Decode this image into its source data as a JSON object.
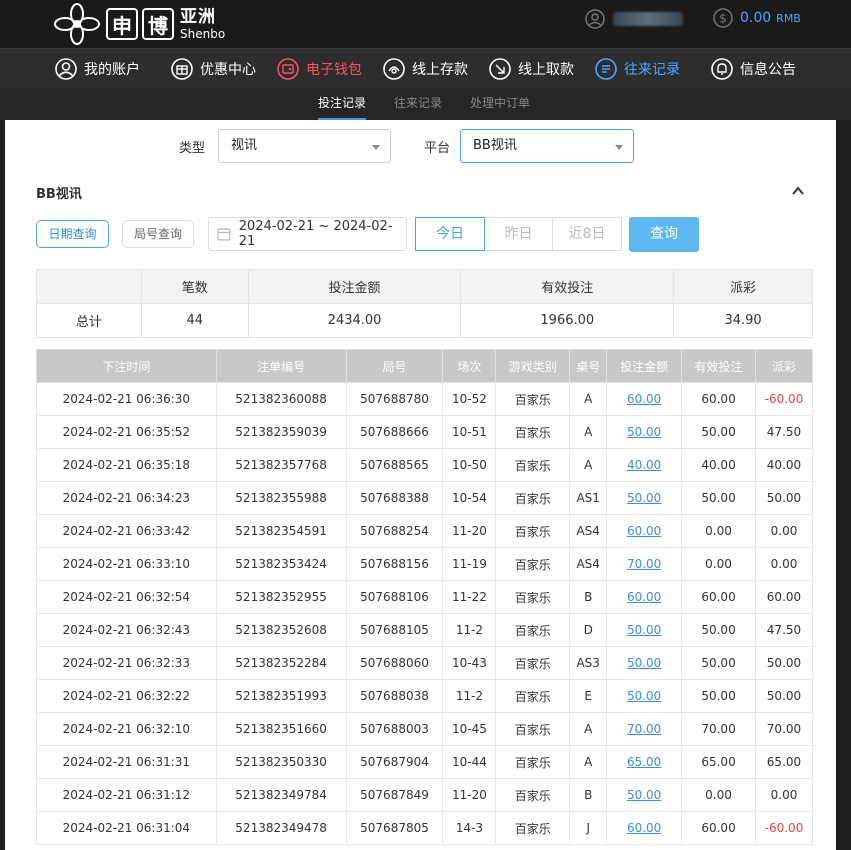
{
  "brand": {
    "logo_char1": "申",
    "logo_char2": "博",
    "cn": "亚洲",
    "en": "Shenbo"
  },
  "account": {
    "balance": "0.00",
    "currency": "RMB"
  },
  "nav": [
    {
      "label": "我的账户",
      "icon": "user-circle-icon"
    },
    {
      "label": "优惠中心",
      "icon": "gift-icon"
    },
    {
      "label": "电子钱包",
      "icon": "wallet-icon"
    },
    {
      "label": "线上存款",
      "icon": "deposit-icon"
    },
    {
      "label": "线上取款",
      "icon": "withdraw-icon"
    },
    {
      "label": "往来记录",
      "icon": "records-icon"
    },
    {
      "label": "信息公告",
      "icon": "bell-icon"
    }
  ],
  "colors": {
    "accent": "#4aa3e8",
    "wallet_active": "#ff4d6a",
    "records_active": "#4aa8ff",
    "negative": "#e84545"
  },
  "subnav": [
    "投注记录",
    "往来记录",
    "处理中订单"
  ],
  "filters": {
    "type_label": "类型",
    "type_value": "视讯",
    "platform_label": "平台",
    "platform_value": "BB视讯"
  },
  "section_title": "BB视讯",
  "query": {
    "date_query": "日期查询",
    "round_query": "局号查询",
    "date_range": "2024-02-21 ~ 2024-02-21",
    "today": "今日",
    "yesterday": "昨日",
    "last8": "近8日",
    "submit": "查询"
  },
  "summary": {
    "headers": [
      "笔数",
      "投注金额",
      "有效投注",
      "派彩"
    ],
    "label": "总计",
    "values": [
      "44",
      "2434.00",
      "1966.00",
      "34.90"
    ]
  },
  "table": {
    "headers": [
      "下注时间",
      "注单编号",
      "局号",
      "场次",
      "游戏类别",
      "桌号",
      "投注金额",
      "有效投注",
      "派彩"
    ],
    "rows": [
      [
        "2024-02-21 06:36:30",
        "521382360088",
        "507688780",
        "10-52",
        "百家乐",
        "A",
        "60.00",
        "60.00",
        "-60.00"
      ],
      [
        "2024-02-21 06:35:52",
        "521382359039",
        "507688666",
        "10-51",
        "百家乐",
        "A",
        "50.00",
        "50.00",
        "47.50"
      ],
      [
        "2024-02-21 06:35:18",
        "521382357768",
        "507688565",
        "10-50",
        "百家乐",
        "A",
        "40.00",
        "40.00",
        "40.00"
      ],
      [
        "2024-02-21 06:34:23",
        "521382355988",
        "507688388",
        "10-54",
        "百家乐",
        "AS1",
        "50.00",
        "50.00",
        "50.00"
      ],
      [
        "2024-02-21 06:33:42",
        "521382354591",
        "507688254",
        "11-20",
        "百家乐",
        "AS4",
        "60.00",
        "0.00",
        "0.00"
      ],
      [
        "2024-02-21 06:33:10",
        "521382353424",
        "507688156",
        "11-19",
        "百家乐",
        "AS4",
        "70.00",
        "0.00",
        "0.00"
      ],
      [
        "2024-02-21 06:32:54",
        "521382352955",
        "507688106",
        "11-22",
        "百家乐",
        "B",
        "60.00",
        "60.00",
        "60.00"
      ],
      [
        "2024-02-21 06:32:43",
        "521382352608",
        "507688105",
        "11-2",
        "百家乐",
        "D",
        "50.00",
        "50.00",
        "47.50"
      ],
      [
        "2024-02-21 06:32:33",
        "521382352284",
        "507688060",
        "10-43",
        "百家乐",
        "AS3",
        "50.00",
        "50.00",
        "50.00"
      ],
      [
        "2024-02-21 06:32:22",
        "521382351993",
        "507688038",
        "11-2",
        "百家乐",
        "E",
        "50.00",
        "50.00",
        "50.00"
      ],
      [
        "2024-02-21 06:32:10",
        "521382351660",
        "507688003",
        "10-45",
        "百家乐",
        "A",
        "70.00",
        "70.00",
        "70.00"
      ],
      [
        "2024-02-21 06:31:31",
        "521382350330",
        "507687904",
        "10-44",
        "百家乐",
        "A",
        "65.00",
        "65.00",
        "65.00"
      ],
      [
        "2024-02-21 06:31:12",
        "521382349784",
        "507687849",
        "11-20",
        "百家乐",
        "B",
        "50.00",
        "0.00",
        "0.00"
      ],
      [
        "2024-02-21 06:31:04",
        "521382349478",
        "507687805",
        "14-3",
        "百家乐",
        "J",
        "60.00",
        "60.00",
        "-60.00"
      ]
    ]
  }
}
